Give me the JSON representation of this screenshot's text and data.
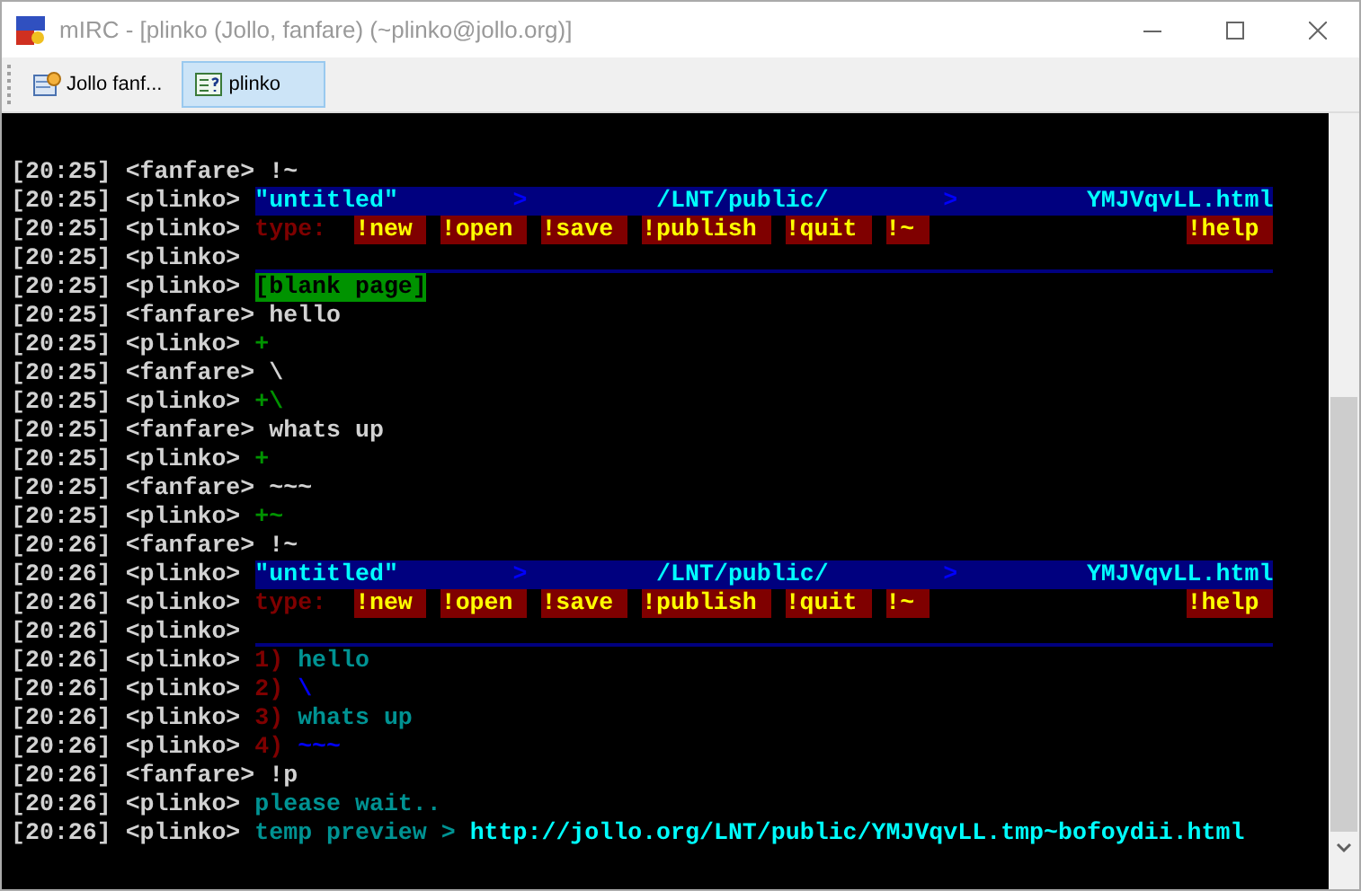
{
  "window": {
    "title": "mIRC - [plinko (Jollo, fanfare) (~plinko@jollo.org)]"
  },
  "tabs": [
    {
      "label": "Jollo fanf...",
      "kind": "channel",
      "selected": false
    },
    {
      "label": "plinko",
      "kind": "query",
      "selected": true
    }
  ],
  "lines": [
    {
      "time": "[20:25]",
      "nick": "<fanfare>",
      "kind": "text",
      "text": "!~"
    },
    {
      "time": "[20:25]",
      "nick": "<plinko>",
      "kind": "header",
      "title": "\"untitled\"",
      "sep1": ">",
      "path": "/LNT/public/",
      "sep2": ">",
      "file": "YMJVqvLL.html"
    },
    {
      "time": "[20:25]",
      "nick": "<plinko>",
      "kind": "menu",
      "label": "type:",
      "commands": [
        "!new",
        "!open",
        "!save",
        "!publish",
        "!quit",
        "!~"
      ],
      "help": "!help"
    },
    {
      "time": "[20:25]",
      "nick": "<plinko>",
      "kind": "rule"
    },
    {
      "time": "[20:25]",
      "nick": "<plinko>",
      "kind": "badge",
      "text": "[blank page]"
    },
    {
      "time": "[20:25]",
      "nick": "<fanfare>",
      "kind": "text",
      "text": "hello"
    },
    {
      "time": "[20:25]",
      "nick": "<plinko>",
      "kind": "plus",
      "text": "+"
    },
    {
      "time": "[20:25]",
      "nick": "<fanfare>",
      "kind": "text",
      "text": "\\"
    },
    {
      "time": "[20:25]",
      "nick": "<plinko>",
      "kind": "plus",
      "text": "+\\"
    },
    {
      "time": "[20:25]",
      "nick": "<fanfare>",
      "kind": "text",
      "text": "whats up"
    },
    {
      "time": "[20:25]",
      "nick": "<plinko>",
      "kind": "plus",
      "text": "+"
    },
    {
      "time": "[20:25]",
      "nick": "<fanfare>",
      "kind": "text",
      "text": "~~~"
    },
    {
      "time": "[20:25]",
      "nick": "<plinko>",
      "kind": "plus",
      "text": "+~"
    },
    {
      "time": "[20:26]",
      "nick": "<fanfare>",
      "kind": "text",
      "text": "!~"
    },
    {
      "time": "[20:26]",
      "nick": "<plinko>",
      "kind": "header",
      "title": "\"untitled\"",
      "sep1": ">",
      "path": "/LNT/public/",
      "sep2": ">",
      "file": "YMJVqvLL.html"
    },
    {
      "time": "[20:26]",
      "nick": "<plinko>",
      "kind": "menu",
      "label": "type:",
      "commands": [
        "!new",
        "!open",
        "!save",
        "!publish",
        "!quit",
        "!~"
      ],
      "help": "!help"
    },
    {
      "time": "[20:26]",
      "nick": "<plinko>",
      "kind": "rule"
    },
    {
      "time": "[20:26]",
      "nick": "<plinko>",
      "kind": "numbered",
      "number": "1)",
      "text": "hello",
      "color": "#009393"
    },
    {
      "time": "[20:26]",
      "nick": "<plinko>",
      "kind": "numbered",
      "number": "2)",
      "text": "\\",
      "color": "#0000fc"
    },
    {
      "time": "[20:26]",
      "nick": "<plinko>",
      "kind": "numbered",
      "number": "3)",
      "text": "whats up",
      "color": "#009393"
    },
    {
      "time": "[20:26]",
      "nick": "<plinko>",
      "kind": "numbered",
      "number": "4)",
      "text": "~~~",
      "color": "#0000fc"
    },
    {
      "time": "[20:26]",
      "nick": "<fanfare>",
      "kind": "text",
      "text": "!p"
    },
    {
      "time": "[20:26]",
      "nick": "<plinko>",
      "kind": "status",
      "text": "please wait.."
    },
    {
      "time": "[20:26]",
      "nick": "<plinko>",
      "kind": "link",
      "label": "temp preview",
      "sep": ">",
      "url": "http://jollo.org/LNT/public/YMJVqvLL.tmp~bofoydii.html"
    }
  ]
}
